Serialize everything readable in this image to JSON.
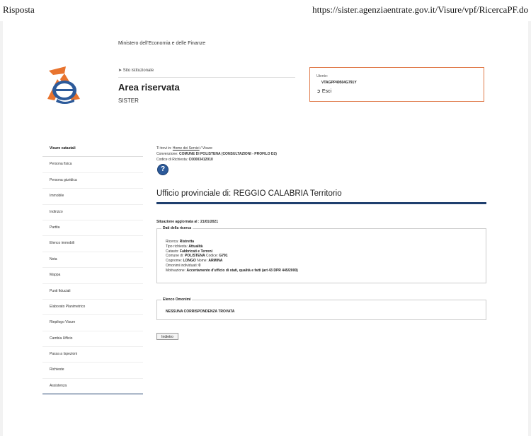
{
  "window": {
    "title": "Risposta",
    "url": "https://sister.agenziaentrate.gov.it/Visure/vpf/RicercaPF.do"
  },
  "header": {
    "ministry": "Ministero dell'Economia e delle Finanze",
    "back_link": "Sito istituzionale",
    "area_title": "Area riservata",
    "subtitle": "SISTER"
  },
  "user": {
    "label": "Utente:",
    "code": "VTAGPP49504G791Y",
    "exit_label": "Esci"
  },
  "sidebar": {
    "items": [
      {
        "label": "Visure catastali"
      },
      {
        "label": "Persona fisica"
      },
      {
        "label": "Persona giuridica"
      },
      {
        "label": "Immobile"
      },
      {
        "label": "Indirizzo"
      },
      {
        "label": "Partita"
      },
      {
        "label": "Elenco immobili"
      },
      {
        "label": "Nota"
      },
      {
        "label": "Mappa"
      },
      {
        "label": "Punti fiduciali"
      },
      {
        "label": "Elaborato Planimetrico"
      },
      {
        "label": "Riepilogo Visure"
      },
      {
        "label": "Cambia Ufficio"
      },
      {
        "label": "Passa a Ispezioni"
      },
      {
        "label": "Richieste"
      },
      {
        "label": "Assistenza"
      }
    ]
  },
  "main": {
    "breadcrumb_prefix": "Ti trovi in:",
    "breadcrumb_link": "Home dei Servizi",
    "breadcrumb_rest": "/ Visure",
    "convention_label": "Convenzione:",
    "convention_value": "COMUNE DI POLISTENA (CONSULTAZIONI - PROFILO D2)",
    "request_code_label": "Codice di Richiesta:",
    "request_code_value": "C00003412010",
    "help_icon": "?",
    "office_title": "Ufficio provinciale di: REGGIO CALABRIA Territorio",
    "updated_label": "Situazione aggiornata al : 21/01/2021",
    "search_data": {
      "legend": "Dati della ricerca",
      "rows": [
        {
          "label": "Ricerca:",
          "value": "Ristretta"
        },
        {
          "label": "Tipo richiesta:",
          "value": "Attualità"
        },
        {
          "label": "Catasto:",
          "value": "Fabbricati e Terreni"
        },
        {
          "label": "Comune di:",
          "value": "POLISTENA",
          "label2": "Codice:",
          "value2": "G791"
        },
        {
          "label": "Cognome:",
          "value": "LONGO",
          "label2": "Nome:",
          "value2": "ARMINA"
        },
        {
          "label": "Omonimi individuati:",
          "value": "0"
        },
        {
          "label": "Motivazione:",
          "value": "Accertamento d'ufficio di stati, qualità e fatti (art 43 DPR 445/2000)"
        }
      ]
    },
    "homonyms": {
      "legend": "Elenco Omonimi",
      "message": "NESSUNA CORRISPONDENZA TROVATA"
    },
    "back_button": "Indietro"
  },
  "colors": {
    "accent_blue": "#1f3f6e",
    "user_box_border": "#e07b4b",
    "logo_orange": "#e8742f",
    "logo_blue": "#2c5a9a"
  }
}
